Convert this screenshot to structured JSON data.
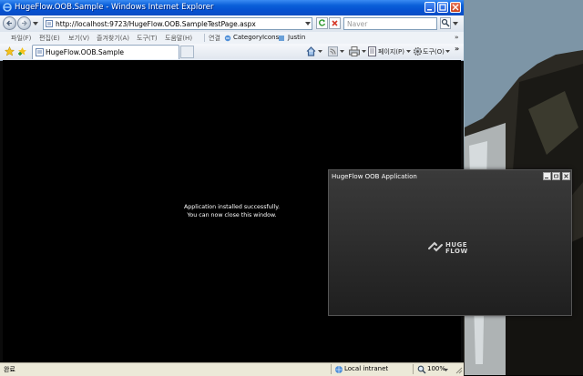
{
  "window": {
    "title": "HugeFlow.OOB.Sample - Windows Internet Explorer"
  },
  "addressbar": {
    "url": "http://localhost:9723/HugeFlow.OOB.SampleTestPage.aspx",
    "search_placeholder": "Naver"
  },
  "menubar": {
    "items": [
      "파일(F)",
      "편집(E)",
      "보기(V)",
      "즐겨찾기(A)",
      "도구(T)",
      "도움말(H)"
    ],
    "links_label": "연결",
    "links": [
      "CategoryIcons",
      "Justin"
    ]
  },
  "tabbar": {
    "active_tab": "HugeFlow.OOB.Sample",
    "page_menu": "페이지(P)",
    "tools_menu": "도구(O)"
  },
  "content": {
    "line1": "Application installed successfully.",
    "line2": "You can now close this window."
  },
  "statusbar": {
    "status": "완료",
    "zone": "Local intranet",
    "zoom": "100%"
  },
  "oob_window": {
    "title": "HugeFlow OOB Application",
    "logo_line1": "HUGE",
    "logo_line2": "FLOW"
  }
}
